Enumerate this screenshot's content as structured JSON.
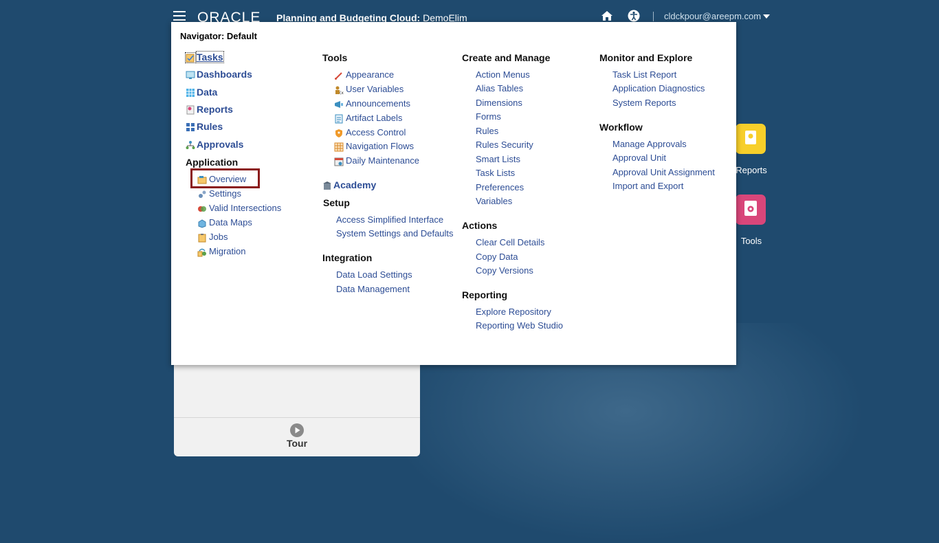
{
  "header": {
    "brand": "ORACLE",
    "app_title": "Planning and Budgeting Cloud:",
    "app_name": "DemoElim",
    "user": "cldckpour@areepm.com"
  },
  "navigator": {
    "title": "Navigator: Default",
    "col1": {
      "main": [
        {
          "label": "Tasks",
          "icon": "tasks-icon"
        },
        {
          "label": "Dashboards",
          "icon": "dashboards-icon"
        },
        {
          "label": "Data",
          "icon": "data-grid-icon"
        },
        {
          "label": "Reports",
          "icon": "reports-icon"
        },
        {
          "label": "Rules",
          "icon": "rules-icon"
        },
        {
          "label": "Approvals",
          "icon": "approvals-icon"
        }
      ],
      "application_header": "Application",
      "application": [
        {
          "label": "Overview",
          "icon": "overview-icon"
        },
        {
          "label": "Settings",
          "icon": "settings-icon"
        },
        {
          "label": "Valid Intersections",
          "icon": "valid-intersections-icon"
        },
        {
          "label": "Data Maps",
          "icon": "data-maps-icon"
        },
        {
          "label": "Jobs",
          "icon": "jobs-icon"
        },
        {
          "label": "Migration",
          "icon": "migration-icon"
        }
      ]
    },
    "col2": {
      "tools_header": "Tools",
      "tools": [
        {
          "label": "Appearance",
          "icon": "appearance-icon"
        },
        {
          "label": "User Variables",
          "icon": "user-variables-icon"
        },
        {
          "label": "Announcements",
          "icon": "announcements-icon"
        },
        {
          "label": "Artifact Labels",
          "icon": "artifact-labels-icon"
        },
        {
          "label": "Access Control",
          "icon": "access-control-icon"
        },
        {
          "label": "Navigation Flows",
          "icon": "navigation-flows-icon"
        },
        {
          "label": "Daily Maintenance",
          "icon": "daily-maintenance-icon"
        }
      ],
      "academy": "Academy",
      "setup_header": "Setup",
      "setup": [
        "Access Simplified Interface",
        "System Settings and Defaults"
      ],
      "integration_header": "Integration",
      "integration": [
        "Data Load Settings",
        "Data Management"
      ]
    },
    "col3": {
      "create_header": "Create and Manage",
      "create": [
        "Action Menus",
        "Alias Tables",
        "Dimensions",
        "Forms",
        "Rules",
        "Rules Security",
        "Smart Lists",
        "Task Lists",
        "Preferences",
        "Variables"
      ],
      "actions_header": "Actions",
      "actions": [
        "Clear Cell Details",
        "Copy Data",
        "Copy Versions"
      ],
      "reporting_header": "Reporting",
      "reporting": [
        "Explore Repository",
        "Reporting Web Studio"
      ]
    },
    "col4": {
      "monitor_header": "Monitor and Explore",
      "monitor": [
        "Task List Report",
        "Application Diagnostics",
        "System Reports"
      ],
      "workflow_header": "Workflow",
      "workflow": [
        "Manage Approvals",
        "Approval Unit",
        "Approval Unit Assignment",
        "Import and Export"
      ]
    }
  },
  "background": {
    "tile_reports": "Reports",
    "tile_tools": "Tools",
    "tour": "Tour"
  },
  "colors": {
    "background": "#1f4a6e",
    "link": "#2d4d95",
    "highlight": "#8b1a1a"
  }
}
